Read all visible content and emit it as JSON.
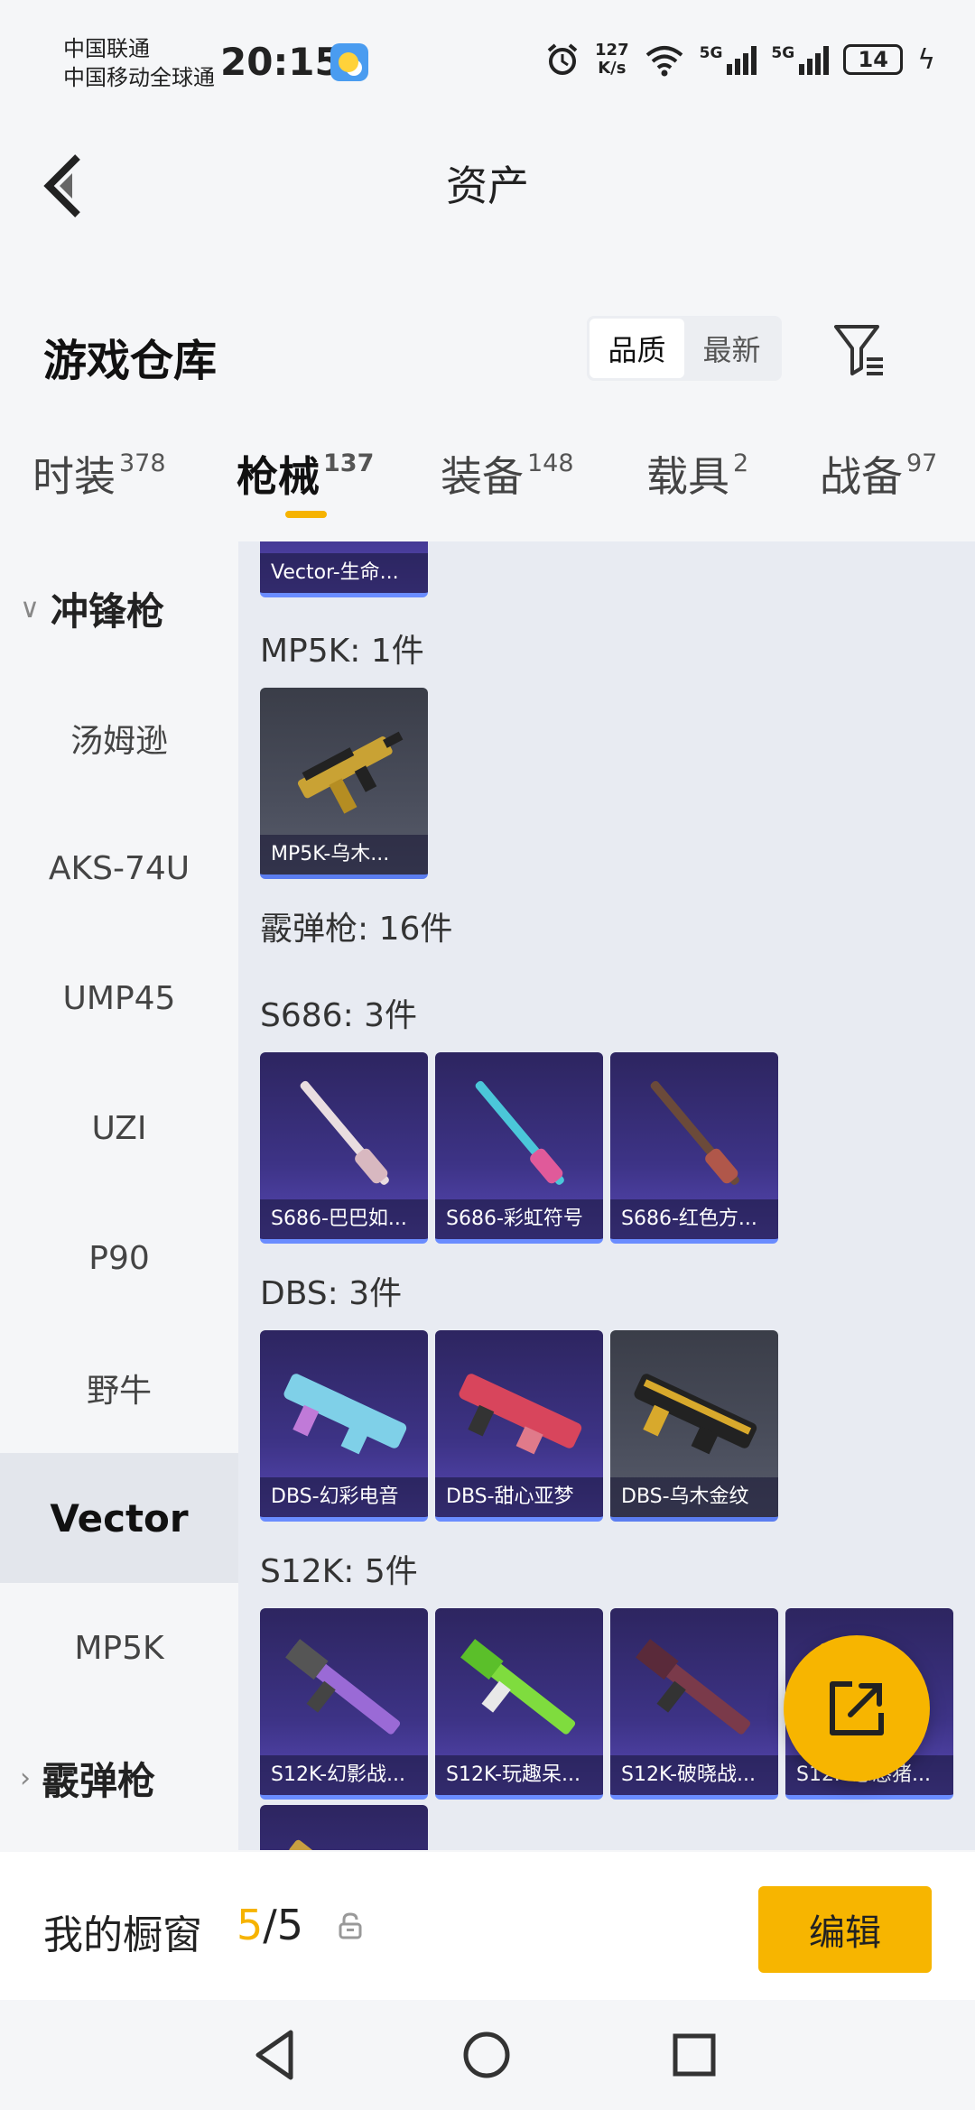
{
  "status_bar": {
    "carrier_1": "中国联通",
    "carrier_2": "中国移动全球通",
    "time": "20:15",
    "net_speed_value": "127",
    "net_speed_unit": "K/s",
    "signal_1_label": "5G",
    "signal_2_label": "5G",
    "battery": "14",
    "icons": [
      "weather-icon",
      "alarm-icon",
      "wifi-icon",
      "signal-icon",
      "signal-icon",
      "battery-icon",
      "charging-icon"
    ]
  },
  "title_bar": {
    "title": "资产"
  },
  "header": {
    "title": "游戏仓库",
    "sort_quality": "品质",
    "sort_newest": "最新"
  },
  "tabs": [
    {
      "label": "时装",
      "count": "378"
    },
    {
      "label": "枪械",
      "count": "137"
    },
    {
      "label": "装备",
      "count": "148"
    },
    {
      "label": "载具",
      "count": "2"
    },
    {
      "label": "战备",
      "count": "97"
    }
  ],
  "sidebar": {
    "group_smg": "冲锋枪",
    "items": [
      "汤姆逊",
      "AKS-74U",
      "UMP45",
      "UZI",
      "P90",
      "野牛",
      "Vector",
      "MP5K"
    ],
    "group_shotgun": "霰弹枪"
  },
  "content": {
    "vector_partial": "Vector-生命...",
    "mp5k_label": "MP5K: 1件",
    "mp5k_items": [
      "MP5K-乌木..."
    ],
    "shotgun_label": "霰弹枪: 16件",
    "s686_label": "S686: 3件",
    "s686_items": [
      "S686-巴巴如...",
      "S686-彩虹符号",
      "S686-红色方..."
    ],
    "dbs_label": "DBS: 3件",
    "dbs_items": [
      "DBS-幻彩电音",
      "DBS-甜心亚梦",
      "DBS-乌木金纹"
    ],
    "s12k_label": "S12K: 5件",
    "s12k_items": [
      "S12K-幻影战...",
      "S12K-玩趣呆...",
      "S12K-破晓战...",
      "S12K-憨憨猪..."
    ]
  },
  "showcase": {
    "label": "我的橱窗",
    "current": "5",
    "separator": "/",
    "total": "5",
    "edit_label": "编辑"
  },
  "colors": {
    "accent": "#f7b500",
    "card_purple": "#3d3386",
    "card_gray": "#4a4e5c"
  }
}
